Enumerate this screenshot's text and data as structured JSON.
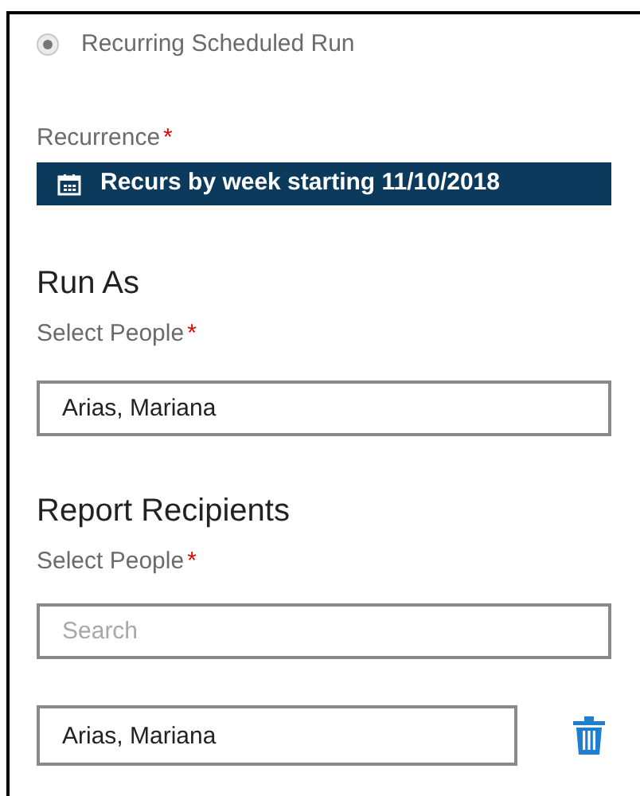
{
  "schedule_option": {
    "label": "Recurring Scheduled Run",
    "selected": true
  },
  "recurrence": {
    "label": "Recurrence",
    "required_mark": "*",
    "value": "Recurs by week starting 11/10/2018"
  },
  "run_as": {
    "heading": "Run As",
    "label": "Select People",
    "required_mark": "*",
    "value": "Arias, Mariana"
  },
  "report_recipients": {
    "heading": "Report Recipients",
    "label": "Select People",
    "required_mark": "*",
    "search": {
      "placeholder": "Search"
    },
    "people": [
      {
        "name": "Arias, Mariana"
      }
    ]
  }
}
